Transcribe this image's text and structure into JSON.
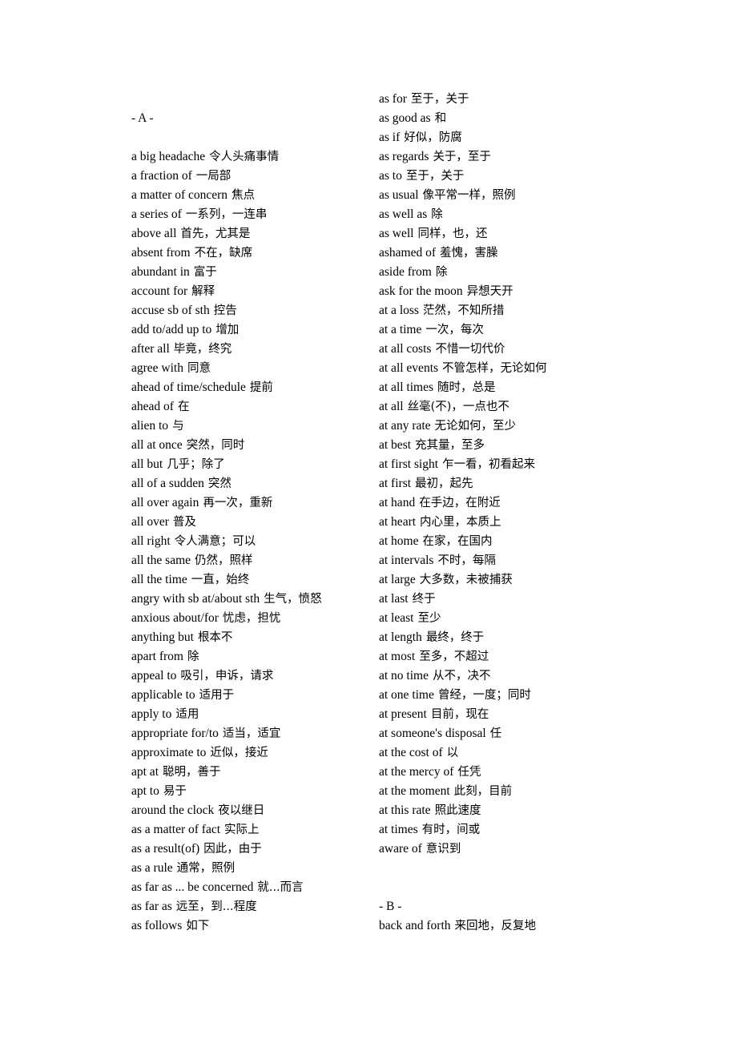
{
  "document": {
    "type": "bilingual-phrase-list",
    "page_background": "#ffffff",
    "text_color": "#000000"
  },
  "left_column": {
    "section_label": "- A -",
    "entries": [
      {
        "term": "a big headache",
        "gloss": "令人头痛事情"
      },
      {
        "term": "a fraction of",
        "gloss": "一局部"
      },
      {
        "term": "a matter of concern",
        "gloss": "焦点"
      },
      {
        "term": "a series of",
        "gloss": "一系列，一连串"
      },
      {
        "term": "above all",
        "gloss": "首先，尤其是"
      },
      {
        "term": "absent from",
        "gloss": "不在，缺席"
      },
      {
        "term": "abundant in",
        "gloss": "富于"
      },
      {
        "term": "account for",
        "gloss": "解释"
      },
      {
        "term": "accuse sb of sth",
        "gloss": "控告"
      },
      {
        "term": "add to/add up to",
        "gloss": "增加"
      },
      {
        "term": "after all",
        "gloss": "毕竟，终究"
      },
      {
        "term": "agree with",
        "gloss": "同意"
      },
      {
        "term": "ahead of time/schedule",
        "gloss": "提前"
      },
      {
        "term": "ahead of",
        "gloss": "在"
      },
      {
        "term": "alien to",
        "gloss": "与"
      },
      {
        "term": "all at once",
        "gloss": "突然，同时"
      },
      {
        "term": "all but",
        "gloss": "几乎；除了"
      },
      {
        "term": "all of a sudden",
        "gloss": "突然"
      },
      {
        "term": "all over again",
        "gloss": "再一次，重新"
      },
      {
        "term": "all over",
        "gloss": "普及"
      },
      {
        "term": "all right",
        "gloss": "令人满意；可以"
      },
      {
        "term": "all the same",
        "gloss": "仍然，照样"
      },
      {
        "term": "all the time",
        "gloss": "一直，始终"
      },
      {
        "term": "angry with sb at/about sth",
        "gloss": "生气，愤怒"
      },
      {
        "term": "anxious about/for",
        "gloss": "忧虑，担忧"
      },
      {
        "term": "anything but",
        "gloss": "根本不"
      },
      {
        "term": "apart from",
        "gloss": "除"
      },
      {
        "term": "appeal to",
        "gloss": "吸引，申诉，请求"
      },
      {
        "term": "applicable to",
        "gloss": "适用于"
      },
      {
        "term": "apply to",
        "gloss": "适用"
      },
      {
        "term": "appropriate for/to",
        "gloss": "适当，适宜"
      },
      {
        "term": "approximate to",
        "gloss": "近似，接近"
      },
      {
        "term": "apt at",
        "gloss": "聪明，善于"
      },
      {
        "term": "apt to",
        "gloss": "易于"
      },
      {
        "term": "around the clock",
        "gloss": "夜以继日"
      },
      {
        "term": "as a matter of fact",
        "gloss": "实际上"
      },
      {
        "term": "as a result(of)",
        "gloss": "因此，由于"
      },
      {
        "term": "as a rule",
        "gloss": "通常，照例"
      },
      {
        "term": "as far as ... be concerned",
        "gloss": "就...而言"
      },
      {
        "term": "as far as",
        "gloss": "远至，到...程度"
      },
      {
        "term": "as follows",
        "gloss": "如下"
      }
    ]
  },
  "right_column": {
    "section_label": "- B -",
    "entries": [
      {
        "term": "as for",
        "gloss": "至于，关于"
      },
      {
        "term": "as good as",
        "gloss": "和"
      },
      {
        "term": "as if",
        "gloss": "好似，防腐"
      },
      {
        "term": "as regards",
        "gloss": "关于，至于"
      },
      {
        "term": "as to",
        "gloss": "至于，关于"
      },
      {
        "term": "as usual",
        "gloss": "像平常一样，照例"
      },
      {
        "term": "as well as",
        "gloss": "除"
      },
      {
        "term": "as well",
        "gloss": "同样，也，还"
      },
      {
        "term": "ashamed of",
        "gloss": "羞愧，害臊"
      },
      {
        "term": "aside from",
        "gloss": "除"
      },
      {
        "term": "ask for the moon",
        "gloss": "异想天开"
      },
      {
        "term": "at a loss",
        "gloss": "茫然，不知所措"
      },
      {
        "term": "at a time",
        "gloss": "一次，每次"
      },
      {
        "term": "at all costs",
        "gloss": "不惜一切代价"
      },
      {
        "term": "at all events",
        "gloss": "不管怎样，无论如何"
      },
      {
        "term": "at all times",
        "gloss": "随时，总是"
      },
      {
        "term": "at all",
        "gloss": "丝毫(不)，一点也不"
      },
      {
        "term": "at any rate",
        "gloss": "无论如何，至少"
      },
      {
        "term": "at best",
        "gloss": "充其量，至多"
      },
      {
        "term": "at first sight",
        "gloss": "乍一看，初看起来"
      },
      {
        "term": "at first",
        "gloss": "最初，起先"
      },
      {
        "term": "at hand",
        "gloss": "在手边，在附近"
      },
      {
        "term": "at heart",
        "gloss": "内心里，本质上"
      },
      {
        "term": "at home",
        "gloss": "在家，在国内"
      },
      {
        "term": "at intervals",
        "gloss": "不时，每隔"
      },
      {
        "term": "at large",
        "gloss": "大多数，未被捕获"
      },
      {
        "term": "at last",
        "gloss": "终于"
      },
      {
        "term": "at least",
        "gloss": "至少"
      },
      {
        "term": "at length",
        "gloss": "最终，终于"
      },
      {
        "term": "at most",
        "gloss": "至多，不超过"
      },
      {
        "term": "at no time",
        "gloss": "从不，决不"
      },
      {
        "term": "at one time",
        "gloss": "曾经，一度；同时"
      },
      {
        "term": "at present",
        "gloss": "目前，现在"
      },
      {
        "term": "at someone's disposal",
        "gloss": "任"
      },
      {
        "term": "at the cost of",
        "gloss": "以"
      },
      {
        "term": "at the mercy of",
        "gloss": "任凭"
      },
      {
        "term": "at the moment",
        "gloss": "此刻，目前"
      },
      {
        "term": "at this rate",
        "gloss": "照此速度"
      },
      {
        "term": "at times",
        "gloss": "有时，间或"
      },
      {
        "term": "aware of",
        "gloss": "意识到"
      }
    ],
    "section_b_entries": [
      {
        "term": "back and forth",
        "gloss": "来回地，反复地"
      }
    ]
  }
}
